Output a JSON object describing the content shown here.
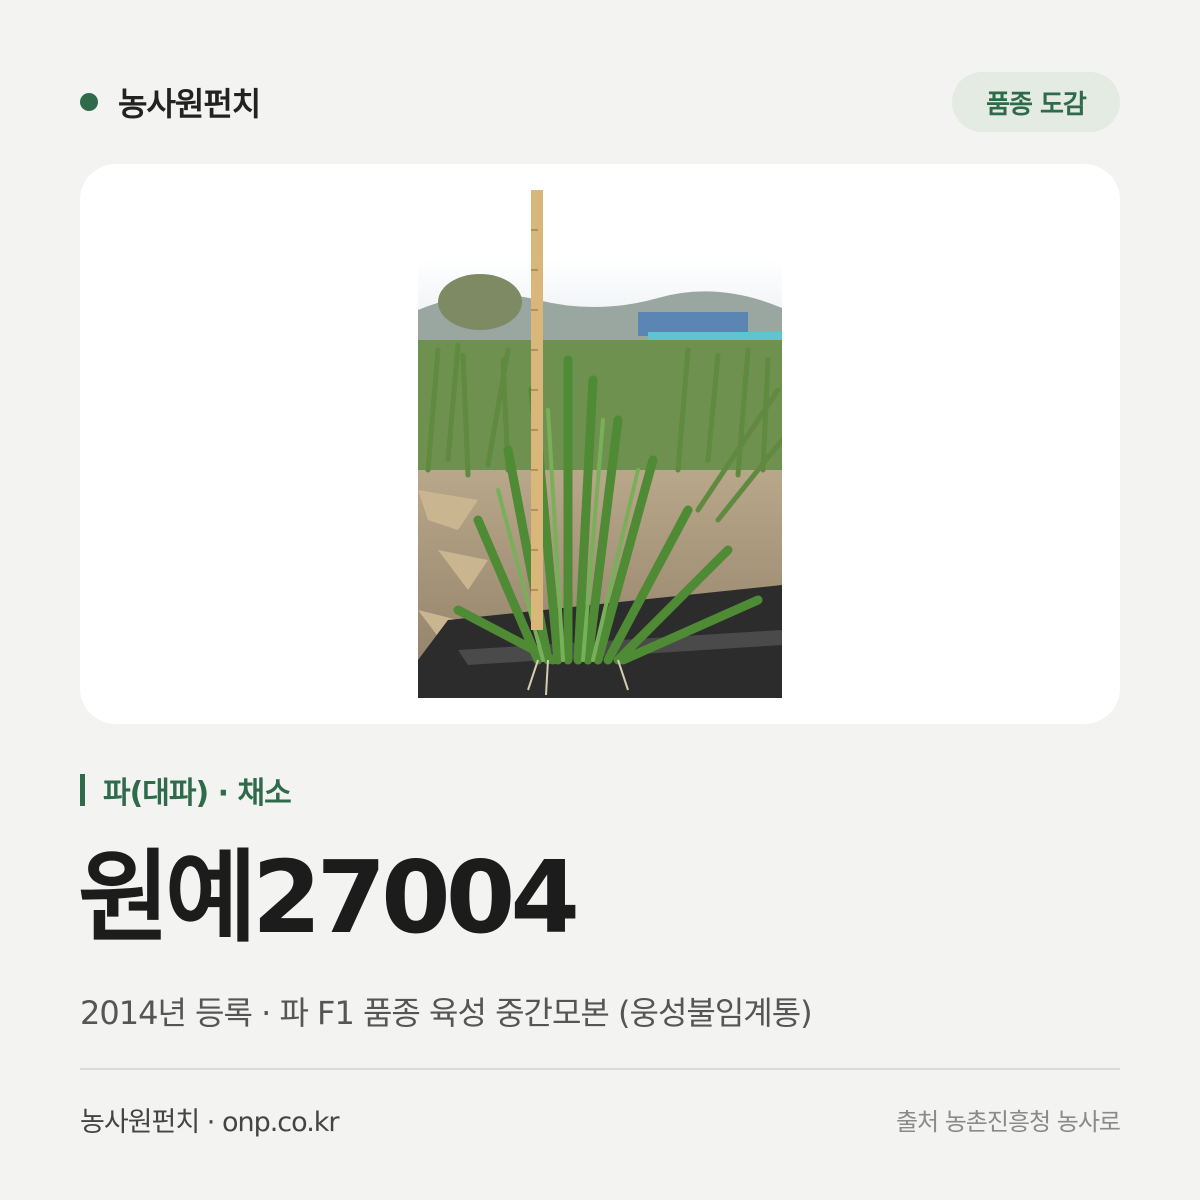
{
  "brand": {
    "name": "농사원펀치"
  },
  "badge": {
    "label": "품종 도감"
  },
  "photo": {
    "subject": "green-onion-field-with-measuring-stick"
  },
  "category": {
    "text": "파(대파) · 채소"
  },
  "variety": {
    "name": "원예27004"
  },
  "description": {
    "text": "2014년 등록 · 파 F1 품종 육성 중간모본 (웅성불임계통)"
  },
  "footer": {
    "left": "농사원펀치 · onp.co.kr",
    "right": "출처 농촌진흥청 농사로"
  },
  "colors": {
    "accent": "#2f6b4a",
    "badge_bg": "#e3ebe3",
    "page_bg": "#f3f3f1",
    "card_bg": "#ffffff"
  }
}
